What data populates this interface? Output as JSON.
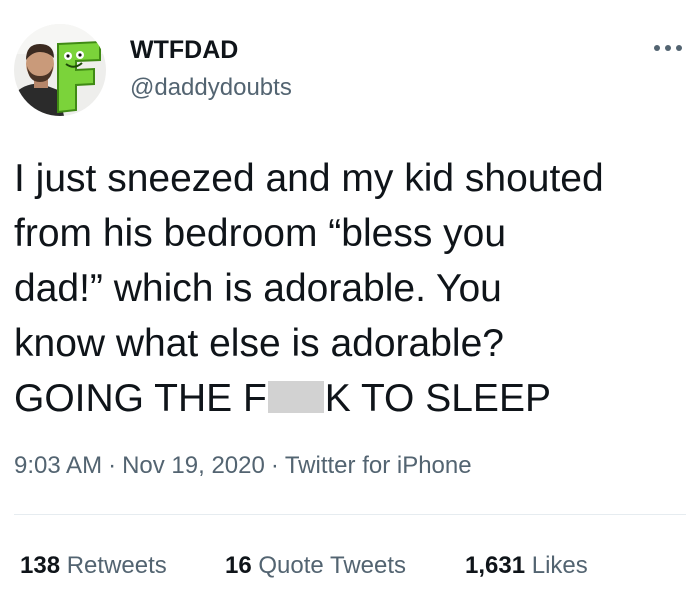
{
  "user": {
    "display_name": "WTFDAD",
    "handle": "@daddydoubts",
    "avatar_icon": "profile-photo-man-with-green-F-logo",
    "more_icon": "more-options-dots-icon"
  },
  "tweet": {
    "lines": [
      "I just sneezed and my kid shouted",
      "from his bedroom “bless you",
      "dad!” which is adorable. You",
      "know what else is adorable?"
    ],
    "last_line_before": "GOING THE F",
    "last_line_after": "K TO SLEEP"
  },
  "meta": {
    "time": "9:03 AM",
    "separator": "·",
    "date": "Nov 19, 2020",
    "source": "Twitter for iPhone"
  },
  "stats": {
    "retweets_count": "138",
    "retweets_label": "Retweets",
    "quote_count": "16",
    "quote_label": "Quote Tweets",
    "likes_count": "1,631",
    "likes_label": "Likes"
  },
  "colors": {
    "text": "#0f1419",
    "secondary": "#536471",
    "logo_green": "#7bd33a",
    "censor": "#d2d2d2"
  }
}
